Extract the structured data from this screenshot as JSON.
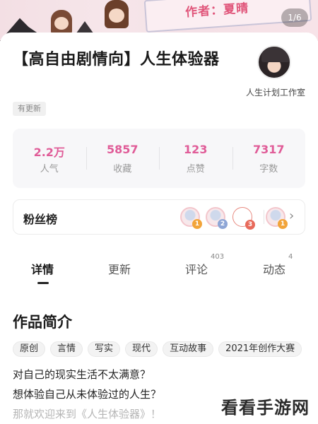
{
  "banner": {
    "author_text": "作者：夏晴",
    "pager": "1/6"
  },
  "book": {
    "title": "【高自由剧情向】人生体验器",
    "update_tag": "有更新",
    "author_name": "人生计划工作室"
  },
  "stats": [
    {
      "value": "2.2万",
      "label": "人气"
    },
    {
      "value": "5857",
      "label": "收藏"
    },
    {
      "value": "123",
      "label": "点赞"
    },
    {
      "value": "7317",
      "label": "字数"
    }
  ],
  "fans": {
    "label": "粉丝榜",
    "ranks": [
      "1",
      "2",
      "3",
      "1"
    ],
    "rank_colors": [
      "#f2a43a",
      "#8ea6d6",
      "#e86a5b",
      "#f2a43a"
    ]
  },
  "tabs": [
    {
      "label": "详情",
      "count": ""
    },
    {
      "label": "更新",
      "count": ""
    },
    {
      "label": "评论",
      "count": "403"
    },
    {
      "label": "动态",
      "count": "4"
    }
  ],
  "intro": {
    "heading": "作品简介",
    "tags": [
      "原创",
      "言情",
      "写实",
      "现代",
      "互动故事",
      "2021年创作大赛"
    ],
    "lines": [
      "对自己的现实生活不太满意？",
      "想体验自己从未体验过的人生？",
      "那就欢迎来到《人生体验器》！"
    ]
  },
  "watermark": "看看手游网",
  "colors": {
    "accent": "#e05c98"
  }
}
